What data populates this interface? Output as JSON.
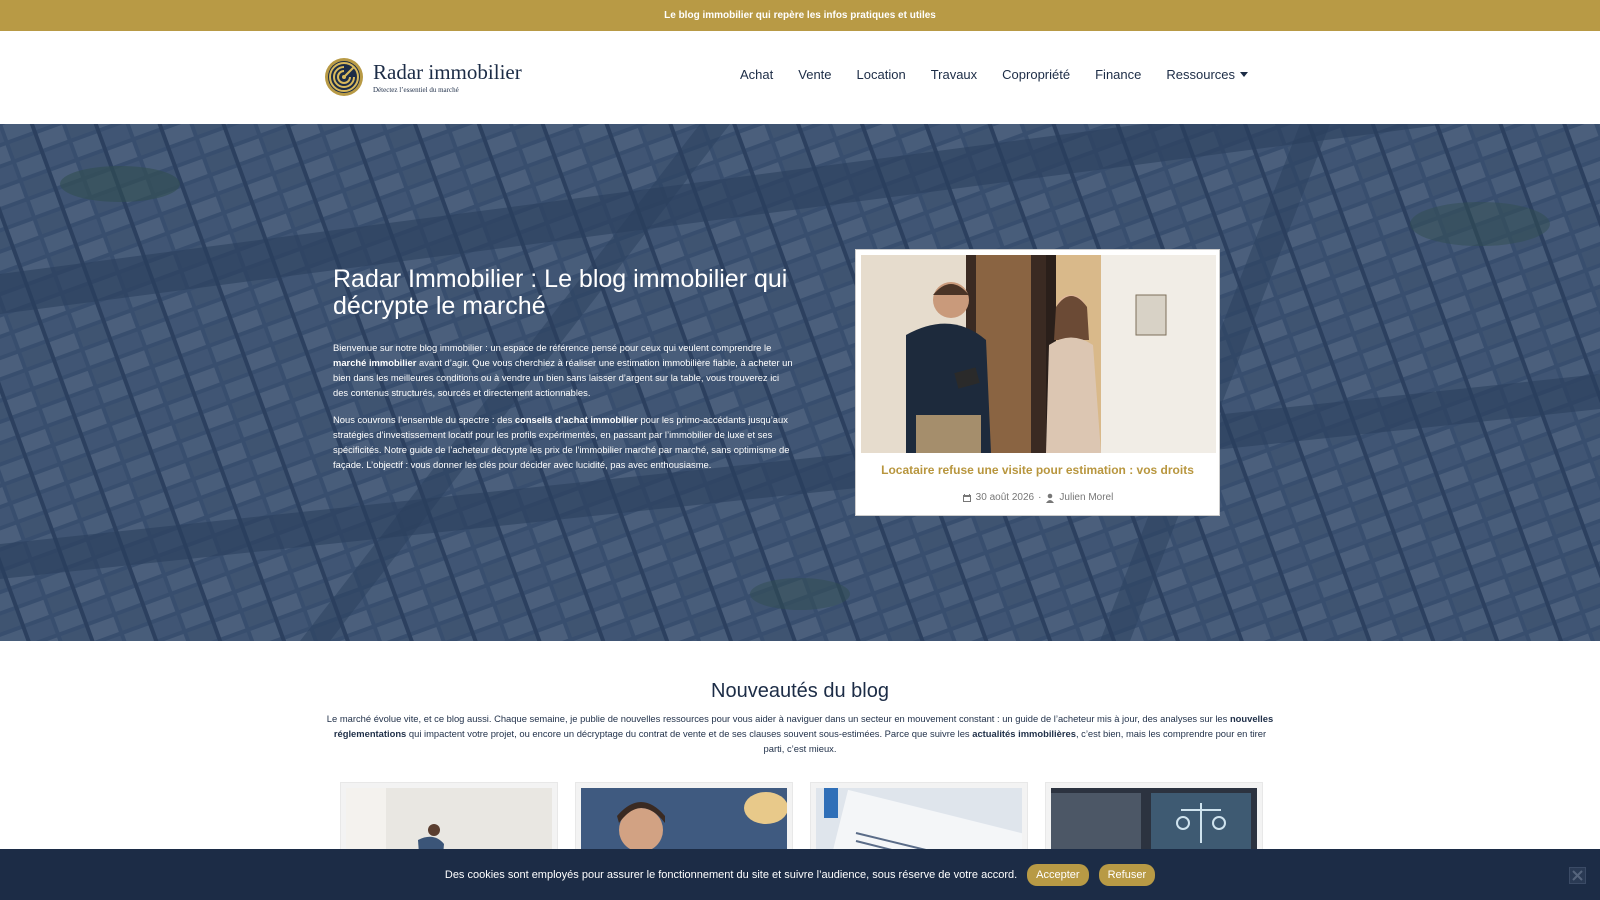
{
  "topbar": {
    "text": "Le blog immobilier qui repère les infos pratiques et utiles"
  },
  "logo": {
    "name": "Radar immobilier",
    "tagline": "Détectez l’essentiel du marché"
  },
  "nav": {
    "items": [
      {
        "label": "Achat"
      },
      {
        "label": "Vente"
      },
      {
        "label": "Location"
      },
      {
        "label": "Travaux"
      },
      {
        "label": "Copropriété"
      },
      {
        "label": "Finance"
      },
      {
        "label": "Ressources"
      }
    ]
  },
  "hero": {
    "title": "Radar Immobilier : Le blog immobilier qui décrypte le marché",
    "p1": {
      "a": "Bienvenue sur notre blog immobilier : un espace de référence pensé pour ceux qui veulent comprendre le ",
      "b": "marché immobilier",
      "c": " avant d’agir. Que vous cherchiez à réaliser une estimation immobilière fiable, à acheter un bien dans les meilleures conditions ou à vendre un bien sans laisser d’argent sur la table, vous trouverez ici des contenus structurés, sourcés et directement actionnables."
    },
    "p2": {
      "a": "Nous couvrons l’ensemble du spectre : des ",
      "b": "conseils d’achat immobilier",
      "c": " pour les primo-accédants jusqu’aux stratégies d’investissement locatif pour les profils expérimentés, en passant par l’immobilier de luxe et ses spécificités. Notre guide de l’acheteur décrypte les prix de l’immobilier marché par marché, sans optimisme de façade. L’objectif : vous donner les clés pour décider avec lucidité, pas avec enthousiasme."
    },
    "feature": {
      "title": "Locataire refuse une visite pour estimation : vos droits",
      "date": "30 août 2026",
      "separator": "·",
      "author": "Julien Morel"
    }
  },
  "news": {
    "title": "Nouveautés du blog",
    "intro": {
      "a": "Le marché évolue vite, et ce blog aussi. Chaque semaine, je publie de nouvelles ressources pour vous aider à naviguer dans un secteur en mouvement constant : un guide de l’acheteur mis à jour, des analyses sur les ",
      "b": "nouvelles réglementations",
      "c": " qui impactent votre projet, ou encore un décryptage du contrat de vente et de ses clauses souvent sous-estimées. Parce que suivre les ",
      "d": "actualités immobilières",
      "e": ", c’est bien, mais les comprendre pour en tirer parti, c’est mieux."
    }
  },
  "cookie": {
    "text": "Des cookies sont employés pour assurer le fonctionnement du site et suivre l’audience, sous réserve de votre accord.",
    "accept": "Accepter",
    "refuse": "Refuser"
  },
  "colors": {
    "gold": "#b89a45",
    "navy": "#1c2c46"
  }
}
